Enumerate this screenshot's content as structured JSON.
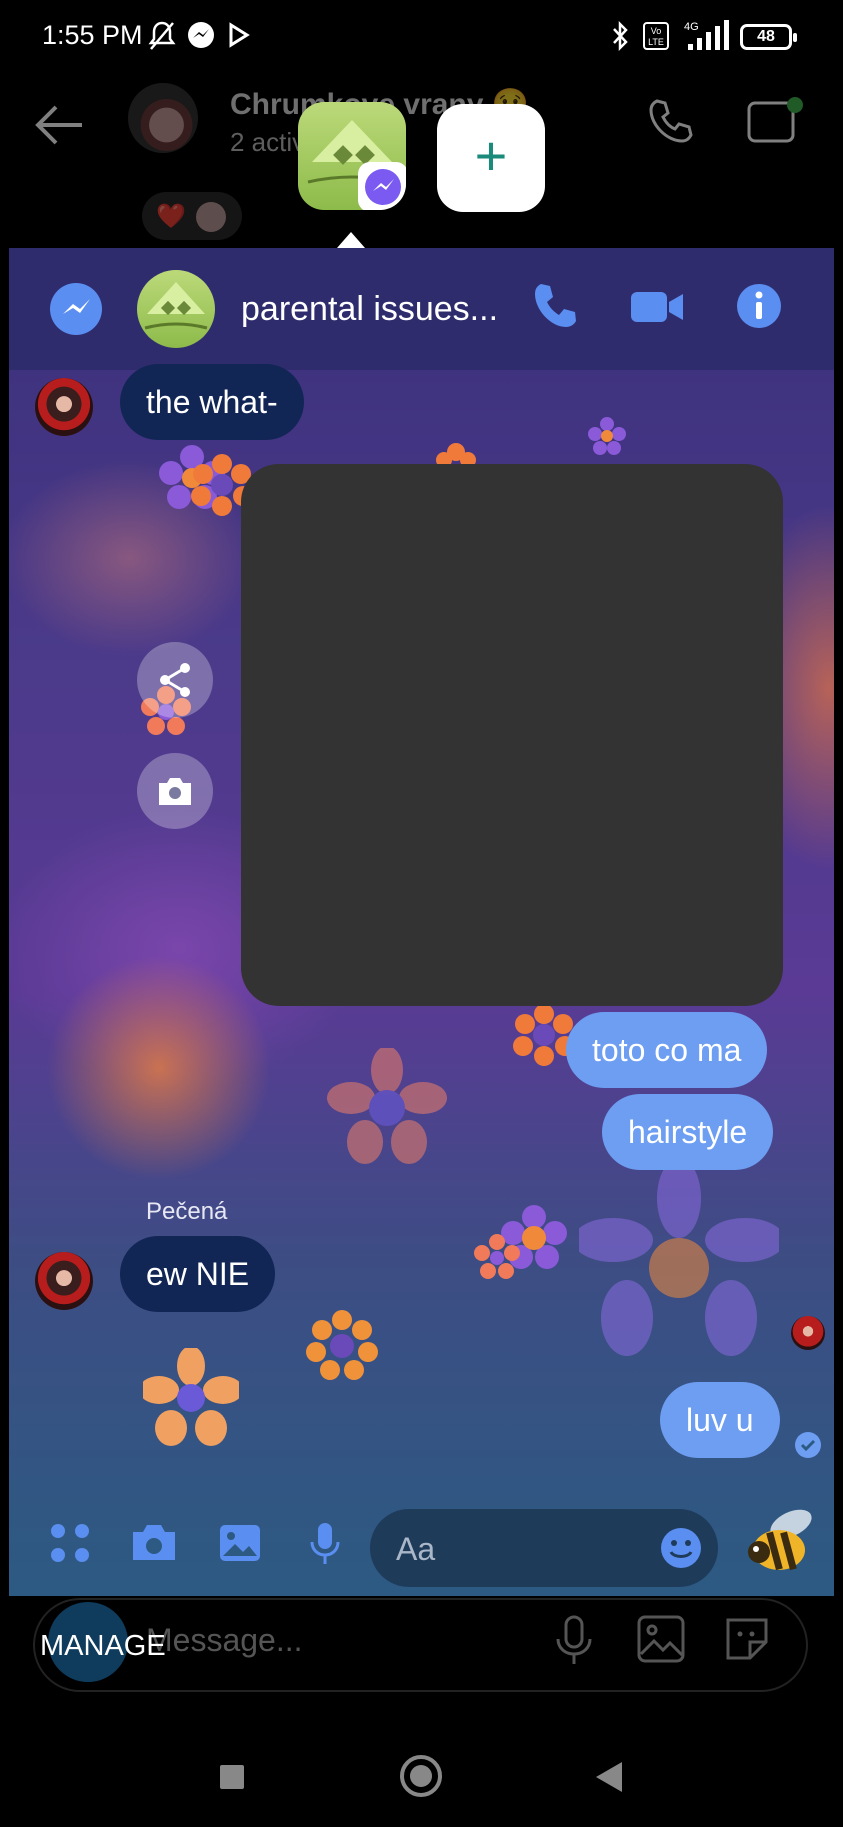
{
  "status_bar": {
    "time": "1:55 PM",
    "battery": "48",
    "network": "4G"
  },
  "background_chat": {
    "title": "Chrumkove vrany 😢",
    "subtitle": "2 activ"
  },
  "chat_bubble": {
    "title": "parental issues...",
    "accent_color": "#5a8ef0",
    "messages": [
      {
        "direction": "in",
        "text": "the what-"
      },
      {
        "direction": "out",
        "text": "toto co ma"
      },
      {
        "direction": "out",
        "text": "hairstyle"
      },
      {
        "direction": "in",
        "sender": "Pečená",
        "text": "ew NIE"
      },
      {
        "direction": "out",
        "text": "luv u"
      }
    ],
    "composer": {
      "placeholder": "Aa"
    }
  },
  "underlying_app": {
    "message_placeholder": "Message...",
    "manage_label": "MANAGE"
  }
}
